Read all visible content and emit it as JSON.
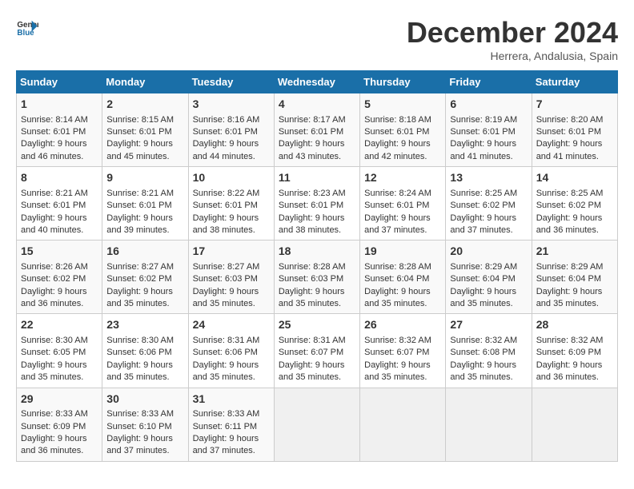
{
  "logo": {
    "line1": "General",
    "line2": "Blue"
  },
  "title": "December 2024",
  "subtitle": "Herrera, Andalusia, Spain",
  "days_of_week": [
    "Sunday",
    "Monday",
    "Tuesday",
    "Wednesday",
    "Thursday",
    "Friday",
    "Saturday"
  ],
  "weeks": [
    [
      {
        "day": "1",
        "sunrise": "8:14 AM",
        "sunset": "6:01 PM",
        "daylight": "9 hours and 46 minutes."
      },
      {
        "day": "2",
        "sunrise": "8:15 AM",
        "sunset": "6:01 PM",
        "daylight": "9 hours and 45 minutes."
      },
      {
        "day": "3",
        "sunrise": "8:16 AM",
        "sunset": "6:01 PM",
        "daylight": "9 hours and 44 minutes."
      },
      {
        "day": "4",
        "sunrise": "8:17 AM",
        "sunset": "6:01 PM",
        "daylight": "9 hours and 43 minutes."
      },
      {
        "day": "5",
        "sunrise": "8:18 AM",
        "sunset": "6:01 PM",
        "daylight": "9 hours and 42 minutes."
      },
      {
        "day": "6",
        "sunrise": "8:19 AM",
        "sunset": "6:01 PM",
        "daylight": "9 hours and 41 minutes."
      },
      {
        "day": "7",
        "sunrise": "8:20 AM",
        "sunset": "6:01 PM",
        "daylight": "9 hours and 41 minutes."
      }
    ],
    [
      {
        "day": "8",
        "sunrise": "8:21 AM",
        "sunset": "6:01 PM",
        "daylight": "9 hours and 40 minutes."
      },
      {
        "day": "9",
        "sunrise": "8:21 AM",
        "sunset": "6:01 PM",
        "daylight": "9 hours and 39 minutes."
      },
      {
        "day": "10",
        "sunrise": "8:22 AM",
        "sunset": "6:01 PM",
        "daylight": "9 hours and 38 minutes."
      },
      {
        "day": "11",
        "sunrise": "8:23 AM",
        "sunset": "6:01 PM",
        "daylight": "9 hours and 38 minutes."
      },
      {
        "day": "12",
        "sunrise": "8:24 AM",
        "sunset": "6:01 PM",
        "daylight": "9 hours and 37 minutes."
      },
      {
        "day": "13",
        "sunrise": "8:25 AM",
        "sunset": "6:02 PM",
        "daylight": "9 hours and 37 minutes."
      },
      {
        "day": "14",
        "sunrise": "8:25 AM",
        "sunset": "6:02 PM",
        "daylight": "9 hours and 36 minutes."
      }
    ],
    [
      {
        "day": "15",
        "sunrise": "8:26 AM",
        "sunset": "6:02 PM",
        "daylight": "9 hours and 36 minutes."
      },
      {
        "day": "16",
        "sunrise": "8:27 AM",
        "sunset": "6:02 PM",
        "daylight": "9 hours and 35 minutes."
      },
      {
        "day": "17",
        "sunrise": "8:27 AM",
        "sunset": "6:03 PM",
        "daylight": "9 hours and 35 minutes."
      },
      {
        "day": "18",
        "sunrise": "8:28 AM",
        "sunset": "6:03 PM",
        "daylight": "9 hours and 35 minutes."
      },
      {
        "day": "19",
        "sunrise": "8:28 AM",
        "sunset": "6:04 PM",
        "daylight": "9 hours and 35 minutes."
      },
      {
        "day": "20",
        "sunrise": "8:29 AM",
        "sunset": "6:04 PM",
        "daylight": "9 hours and 35 minutes."
      },
      {
        "day": "21",
        "sunrise": "8:29 AM",
        "sunset": "6:04 PM",
        "daylight": "9 hours and 35 minutes."
      }
    ],
    [
      {
        "day": "22",
        "sunrise": "8:30 AM",
        "sunset": "6:05 PM",
        "daylight": "9 hours and 35 minutes."
      },
      {
        "day": "23",
        "sunrise": "8:30 AM",
        "sunset": "6:06 PM",
        "daylight": "9 hours and 35 minutes."
      },
      {
        "day": "24",
        "sunrise": "8:31 AM",
        "sunset": "6:06 PM",
        "daylight": "9 hours and 35 minutes."
      },
      {
        "day": "25",
        "sunrise": "8:31 AM",
        "sunset": "6:07 PM",
        "daylight": "9 hours and 35 minutes."
      },
      {
        "day": "26",
        "sunrise": "8:32 AM",
        "sunset": "6:07 PM",
        "daylight": "9 hours and 35 minutes."
      },
      {
        "day": "27",
        "sunrise": "8:32 AM",
        "sunset": "6:08 PM",
        "daylight": "9 hours and 35 minutes."
      },
      {
        "day": "28",
        "sunrise": "8:32 AM",
        "sunset": "6:09 PM",
        "daylight": "9 hours and 36 minutes."
      }
    ],
    [
      {
        "day": "29",
        "sunrise": "8:33 AM",
        "sunset": "6:09 PM",
        "daylight": "9 hours and 36 minutes."
      },
      {
        "day": "30",
        "sunrise": "8:33 AM",
        "sunset": "6:10 PM",
        "daylight": "9 hours and 37 minutes."
      },
      {
        "day": "31",
        "sunrise": "8:33 AM",
        "sunset": "6:11 PM",
        "daylight": "9 hours and 37 minutes."
      },
      null,
      null,
      null,
      null
    ]
  ],
  "labels": {
    "sunrise": "Sunrise:",
    "sunset": "Sunset:",
    "daylight": "Daylight:"
  }
}
